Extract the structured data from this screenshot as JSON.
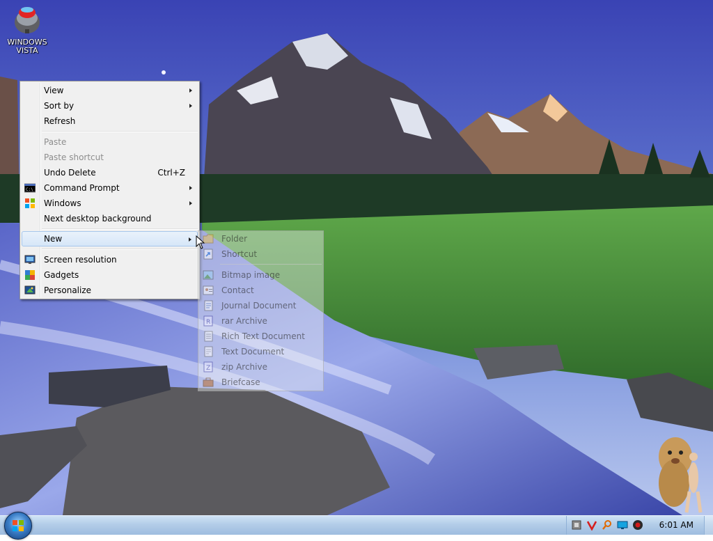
{
  "desktop": {
    "icons": [
      {
        "label": "WINDOWS VISTA",
        "icon": "vista-ball-icon"
      }
    ]
  },
  "context_menu": {
    "items": [
      {
        "label": "View",
        "submenu": true,
        "enabled": true
      },
      {
        "label": "Sort by",
        "submenu": true,
        "enabled": true
      },
      {
        "label": "Refresh",
        "enabled": true
      },
      {
        "label": "Paste",
        "enabled": false
      },
      {
        "label": "Paste shortcut",
        "enabled": false
      },
      {
        "label": "Undo Delete",
        "shortcut": "Ctrl+Z",
        "enabled": true
      },
      {
        "label": "Command Prompt",
        "submenu": true,
        "icon": "command-prompt-icon",
        "enabled": true
      },
      {
        "label": "Windows",
        "submenu": true,
        "icon": "windows-flag-icon",
        "enabled": true
      },
      {
        "label": "Next desktop background",
        "enabled": true
      },
      {
        "label": "New",
        "submenu": true,
        "enabled": true,
        "highlighted": true
      },
      {
        "label": "Screen resolution",
        "icon": "monitor-icon",
        "enabled": true
      },
      {
        "label": "Gadgets",
        "icon": "gadgets-icon",
        "enabled": true
      },
      {
        "label": "Personalize",
        "icon": "personalize-icon",
        "enabled": true
      }
    ]
  },
  "new_submenu": {
    "items": [
      {
        "label": "Folder",
        "icon": "folder-icon"
      },
      {
        "label": "Shortcut",
        "icon": "shortcut-icon"
      },
      {
        "label": "Bitmap image",
        "icon": "bitmap-icon"
      },
      {
        "label": "Contact",
        "icon": "contact-icon"
      },
      {
        "label": "Journal Document",
        "icon": "journal-icon"
      },
      {
        "label": "rar Archive",
        "icon": "rar-icon"
      },
      {
        "label": "Rich Text Document",
        "icon": "rtf-icon"
      },
      {
        "label": "Text Document",
        "icon": "text-document-icon"
      },
      {
        "label": "zip Archive",
        "icon": "zip-icon"
      },
      {
        "label": "Briefcase",
        "icon": "briefcase-icon"
      }
    ]
  },
  "taskbar": {
    "clock": "6:01 AM",
    "tray_icons": [
      "tray-tool-icon",
      "tray-antivirus-icon",
      "tray-search-icon",
      "tray-monitor-icon",
      "tray-media-icon"
    ]
  },
  "colors": {
    "menu_bg": "#f0f0f0",
    "highlight": "#d6e6f8",
    "taskbar": "#b3cde8"
  }
}
